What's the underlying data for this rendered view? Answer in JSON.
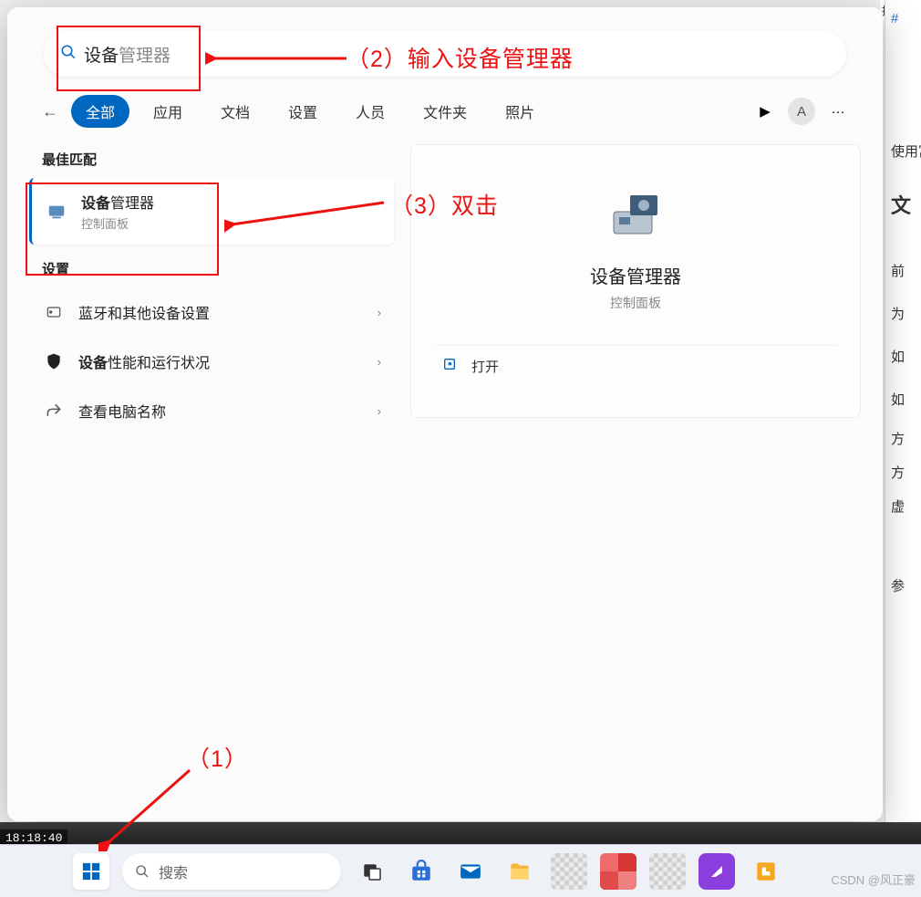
{
  "background_text": {
    "top_fragment": "技术成",
    "use_rich": "使用富",
    "heading_fragment": "文",
    "line_qian": "前",
    "line_wei": "为",
    "line_ru1": "如",
    "line_ru2": "如",
    "line_fang1": "方",
    "line_fang2": "方",
    "line_xu": "虚",
    "line_can": "参",
    "hash": "#"
  },
  "search": {
    "typed": "设备",
    "suggestion": "管理器"
  },
  "tabs": {
    "all": "全部",
    "apps": "应用",
    "docs": "文档",
    "settings": "设置",
    "people": "人员",
    "folders": "文件夹",
    "photos": "照片"
  },
  "avatar_letter": "A",
  "sections": {
    "best_match": "最佳匹配",
    "settings": "设置"
  },
  "best_result": {
    "title_bold": "设备",
    "title_rest": "管理器",
    "subtitle": "控制面板"
  },
  "settings_results": {
    "bluetooth": "蓝牙和其他设备设置",
    "perf_bold": "设备",
    "perf_rest": "性能和运行状况",
    "pc_name": "查看电脑名称"
  },
  "detail": {
    "title": "设备管理器",
    "subtitle": "控制面板",
    "open": "打开"
  },
  "taskbar": {
    "search_placeholder": "搜索"
  },
  "clock_overlay": "18:18:40",
  "annotations": {
    "step1": "（1）",
    "step2": "（2）输入设备管理器",
    "step3": "（3）双击"
  },
  "watermark": "CSDN @风正豪"
}
